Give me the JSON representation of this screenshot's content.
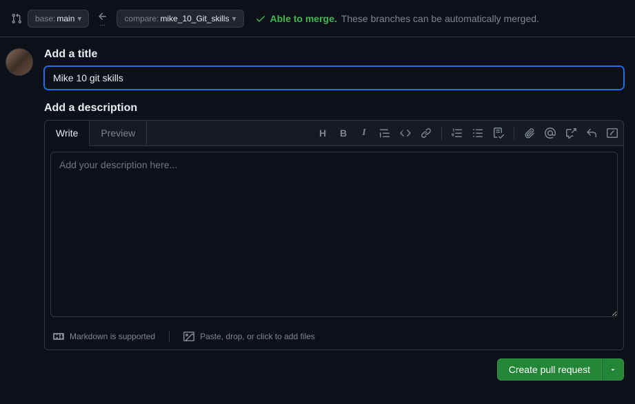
{
  "branches": {
    "base_label": "base:",
    "base_value": "main",
    "compare_label": "compare:",
    "compare_value": "mike_10_Git_skills"
  },
  "merge": {
    "status": "Able to merge.",
    "message": "These branches can be automatically merged."
  },
  "title_section": {
    "label": "Add a title",
    "value": "Mike 10 git skills"
  },
  "desc_section": {
    "label": "Add a description",
    "placeholder": "Add your description here...",
    "value": ""
  },
  "tabs": {
    "write": "Write",
    "preview": "Preview"
  },
  "footer": {
    "markdown": "Markdown is supported",
    "attach": "Paste, drop, or click to add files"
  },
  "actions": {
    "create": "Create pull request"
  }
}
